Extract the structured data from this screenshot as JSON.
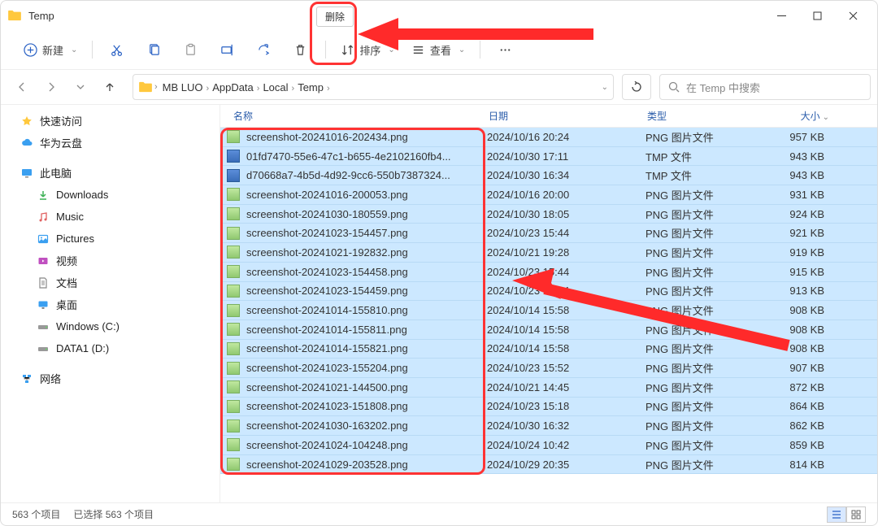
{
  "window_title": "Temp",
  "toolbar": {
    "new_label": "新建",
    "sort_label": "排序",
    "view_label": "查看",
    "delete_tooltip": "删除"
  },
  "breadcrumbs": [
    "MB LUO",
    "AppData",
    "Local",
    "Temp"
  ],
  "search_placeholder": "在 Temp 中搜索",
  "sidebar": {
    "quick_access": "快速访问",
    "huawei": "华为云盘",
    "this_pc": "此电脑",
    "downloads": "Downloads",
    "music": "Music",
    "pictures": "Pictures",
    "videos": "视频",
    "documents": "文档",
    "desktop": "桌面",
    "c_drive": "Windows (C:)",
    "d_drive": "DATA1 (D:)",
    "network": "网络"
  },
  "columns": {
    "name": "名称",
    "date": "日期",
    "type": "类型",
    "size": "大小"
  },
  "files": [
    {
      "name": "screenshot-20241016-202434.png",
      "date": "2024/10/16 20:24",
      "type": "PNG 图片文件",
      "size": "957 KB",
      "tmp": false
    },
    {
      "name": "01fd7470-55e6-47c1-b655-4e2102160fb4...",
      "date": "2024/10/30 17:11",
      "type": "TMP 文件",
      "size": "943 KB",
      "tmp": true
    },
    {
      "name": "d70668a7-4b5d-4d92-9cc6-550b7387324...",
      "date": "2024/10/30 16:34",
      "type": "TMP 文件",
      "size": "943 KB",
      "tmp": true
    },
    {
      "name": "screenshot-20241016-200053.png",
      "date": "2024/10/16 20:00",
      "type": "PNG 图片文件",
      "size": "931 KB",
      "tmp": false
    },
    {
      "name": "screenshot-20241030-180559.png",
      "date": "2024/10/30 18:05",
      "type": "PNG 图片文件",
      "size": "924 KB",
      "tmp": false
    },
    {
      "name": "screenshot-20241023-154457.png",
      "date": "2024/10/23 15:44",
      "type": "PNG 图片文件",
      "size": "921 KB",
      "tmp": false
    },
    {
      "name": "screenshot-20241021-192832.png",
      "date": "2024/10/21 19:28",
      "type": "PNG 图片文件",
      "size": "919 KB",
      "tmp": false
    },
    {
      "name": "screenshot-20241023-154458.png",
      "date": "2024/10/23 15:44",
      "type": "PNG 图片文件",
      "size": "915 KB",
      "tmp": false
    },
    {
      "name": "screenshot-20241023-154459.png",
      "date": "2024/10/23 15:44",
      "type": "PNG 图片文件",
      "size": "913 KB",
      "tmp": false
    },
    {
      "name": "screenshot-20241014-155810.png",
      "date": "2024/10/14 15:58",
      "type": "PNG 图片文件",
      "size": "908 KB",
      "tmp": false
    },
    {
      "name": "screenshot-20241014-155811.png",
      "date": "2024/10/14 15:58",
      "type": "PNG 图片文件",
      "size": "908 KB",
      "tmp": false
    },
    {
      "name": "screenshot-20241014-155821.png",
      "date": "2024/10/14 15:58",
      "type": "PNG 图片文件",
      "size": "908 KB",
      "tmp": false
    },
    {
      "name": "screenshot-20241023-155204.png",
      "date": "2024/10/23 15:52",
      "type": "PNG 图片文件",
      "size": "907 KB",
      "tmp": false
    },
    {
      "name": "screenshot-20241021-144500.png",
      "date": "2024/10/21 14:45",
      "type": "PNG 图片文件",
      "size": "872 KB",
      "tmp": false
    },
    {
      "name": "screenshot-20241023-151808.png",
      "date": "2024/10/23 15:18",
      "type": "PNG 图片文件",
      "size": "864 KB",
      "tmp": false
    },
    {
      "name": "screenshot-20241030-163202.png",
      "date": "2024/10/30 16:32",
      "type": "PNG 图片文件",
      "size": "862 KB",
      "tmp": false
    },
    {
      "name": "screenshot-20241024-104248.png",
      "date": "2024/10/24 10:42",
      "type": "PNG 图片文件",
      "size": "859 KB",
      "tmp": false
    },
    {
      "name": "screenshot-20241029-203528.png",
      "date": "2024/10/29 20:35",
      "type": "PNG 图片文件",
      "size": "814 KB",
      "tmp": false
    }
  ],
  "status": {
    "items": "563 个项目",
    "selected": "已选择 563 个项目"
  }
}
